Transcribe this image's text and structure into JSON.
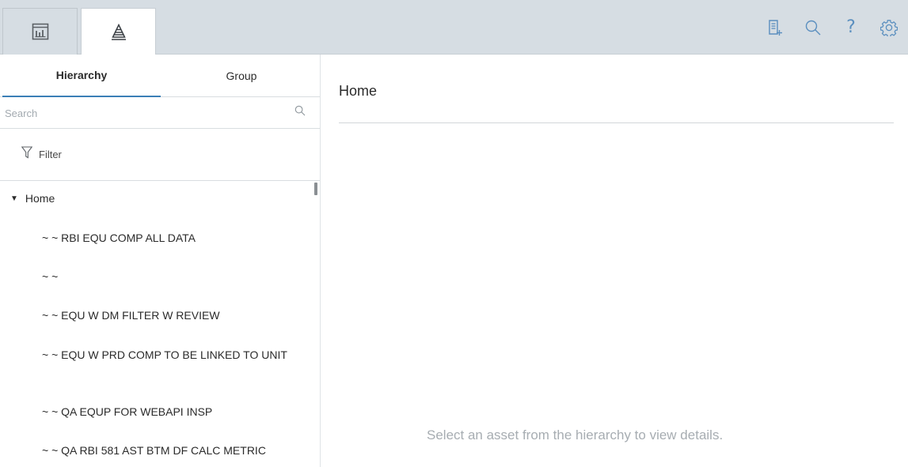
{
  "toolbar": {
    "tabs": [
      {
        "icon": "dashboard-chart-icon",
        "active": false
      },
      {
        "icon": "hierarchy-pyramid-icon",
        "active": true
      }
    ],
    "actions": [
      {
        "icon": "add-record-icon"
      },
      {
        "icon": "search-icon"
      },
      {
        "icon": "help-icon",
        "glyph": "?"
      },
      {
        "icon": "settings-gear-icon"
      }
    ],
    "accent_color": "#5b8fbf"
  },
  "left_panel": {
    "tabs": [
      {
        "label": "Hierarchy",
        "active": true
      },
      {
        "label": "Group",
        "active": false
      }
    ],
    "search": {
      "placeholder": "Search",
      "value": ""
    },
    "filter_label": "Filter",
    "tree": {
      "root_label": "Home",
      "root_expanded": true,
      "children": [
        "~ ~ RBI EQU COMP ALL DATA",
        "~ ~",
        "~ ~ EQU W DM FILTER W REVIEW",
        "~ ~ EQU W PRD COMP TO BE LINKED TO UNIT",
        "~ ~ QA EQUP FOR WEBAPI INSP",
        "~ ~ QA RBI 581 AST BTM DF CALC METRIC"
      ]
    }
  },
  "main": {
    "title": "Home",
    "empty_message": "Select an asset from the hierarchy to view details."
  }
}
